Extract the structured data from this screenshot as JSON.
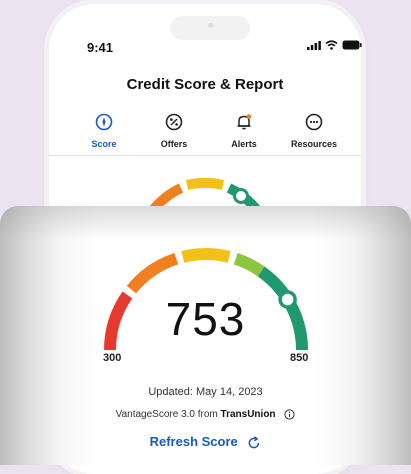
{
  "status_bar": {
    "time": "9:41"
  },
  "header": {
    "title": "Credit Score & Report"
  },
  "tabs": [
    {
      "label": "Score",
      "icon": "compass-icon",
      "active": true
    },
    {
      "label": "Offers",
      "icon": "percent-icon",
      "active": false
    },
    {
      "label": "Alerts",
      "icon": "bell-icon",
      "active": false
    },
    {
      "label": "Resources",
      "icon": "more-icon",
      "active": false
    }
  ],
  "score_card": {
    "score": "753",
    "min_label": "300",
    "max_label": "850",
    "score_value": 753,
    "range": [
      300,
      850
    ],
    "updated": "Updated: May 14, 2023",
    "model_prefix": "VantageScore 3.0 from ",
    "bureau": "TransUnion",
    "refresh_label": "Refresh Score"
  },
  "colors": {
    "accent": "#1a5ab8",
    "gauge_red": "#e8392e",
    "gauge_orange": "#f07f1f",
    "gauge_yellow": "#f3c018",
    "gauge_green_light": "#8cc63f",
    "gauge_green": "#1e9a6e"
  }
}
